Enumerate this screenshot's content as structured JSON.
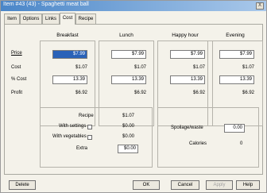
{
  "window": {
    "title": "Item #43 (43) - Spaghetti meat ball",
    "close_glyph": "X"
  },
  "tabs": [
    {
      "label": "Item"
    },
    {
      "label": "Options"
    },
    {
      "label": "Links"
    },
    {
      "label": "Cost"
    },
    {
      "label": "Recipe"
    }
  ],
  "row_labels": {
    "price": "Price",
    "cost": "Cost",
    "pct_cost": "% Cost",
    "profit": "Profit"
  },
  "columns": [
    {
      "header": "Breakfast",
      "price": "$7.99",
      "cost": "$1.07",
      "pct_cost": "13.39",
      "profit": "$6.92"
    },
    {
      "header": "Lunch",
      "price": "$7.99",
      "cost": "$1.07",
      "pct_cost": "13.39",
      "profit": "$6.92"
    },
    {
      "header": "Happy hour",
      "price": "$7.99",
      "cost": "$1.07",
      "pct_cost": "13.39",
      "profit": "$6.92"
    },
    {
      "header": "Evening",
      "price": "$7.99",
      "cost": "$1.07",
      "pct_cost": "13.39",
      "profit": "$6.92"
    }
  ],
  "recipe": {
    "recipe_label": "Recipe",
    "recipe_value": "$1.07",
    "with_settings_label": "With settings",
    "with_settings_value": "$0.00",
    "with_vegetables_label": "With vegetables",
    "with_vegetables_value": "$0.00",
    "extra_label": "Extra",
    "extra_value": "$0.00"
  },
  "side": {
    "spoilage_label": "Spoilage/waste",
    "spoilage_value": "0.00",
    "calories_label": "Calories",
    "calories_value": "0"
  },
  "buttons": {
    "delete": "Delete",
    "ok": "OK",
    "cancel": "Cancel",
    "apply": "Apply",
    "help": "Help"
  }
}
